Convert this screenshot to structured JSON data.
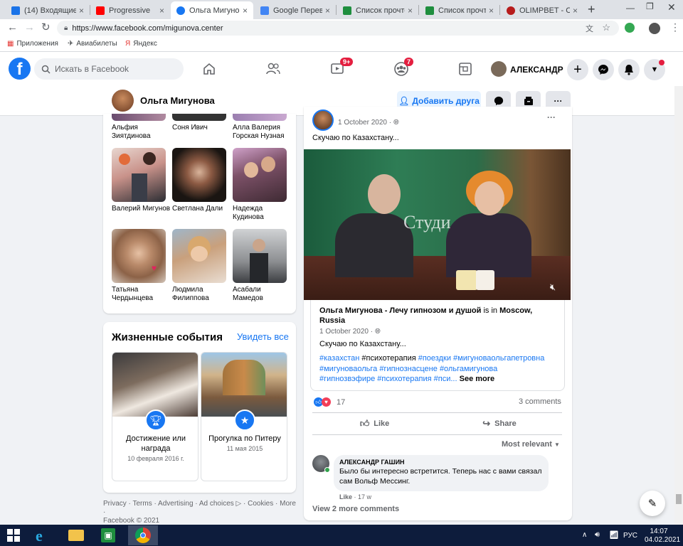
{
  "browser": {
    "tabs": [
      {
        "title": "(14) Входящие -",
        "color": "#1a73e8"
      },
      {
        "title": "Progressive",
        "color": "#ff0000"
      },
      {
        "title": "Ольга Мигунова",
        "color": "#1877f2"
      },
      {
        "title": "Google Перевод",
        "color": "#4285f4"
      },
      {
        "title": "Список прочтен",
        "color": "#1e8e3e"
      },
      {
        "title": "Список прочтен",
        "color": "#1e8e3e"
      },
      {
        "title": "OLIMPBET - Спо",
        "color": "#b71c1c"
      }
    ],
    "url": "https://www.facebook.com/migunova.center",
    "bookmarks": [
      "Приложения",
      "Авиабилеты",
      "Яндекс"
    ]
  },
  "fbnav": {
    "search_placeholder": "Искать в Facebook",
    "video_badge": "9+",
    "groups_badge": "7",
    "user_name": "АЛЕКСАНДР"
  },
  "profile": {
    "name": "Ольга Мигунова",
    "add_friend": "Добавить друга"
  },
  "friends": {
    "top_row": [
      "Альфия Зиятдинова",
      "Соня Ивич",
      "Алла Валерия Горская Нузная"
    ],
    "row2": [
      "Валерий Мигунов",
      "Светлана Дали",
      "Надежда Кудинова"
    ],
    "row3": [
      "Татьяна Чердынцева",
      "Людмила Филиппова",
      "Асабали Мамедов"
    ]
  },
  "life_events": {
    "title": "Жизненные события",
    "see_all": "Увидеть все",
    "items": [
      {
        "title": "Достижение или награда",
        "date": "10 февраля 2016 г."
      },
      {
        "title": "Прогулка по Питеру",
        "date": "11 мая 2015"
      }
    ]
  },
  "footer": {
    "links": "Privacy · Terms · Advertising · Ad choices ▷ · Cookies · More ·",
    "copyright": "Facebook © 2021"
  },
  "post": {
    "date": "1 October 2020 ·",
    "text": "Скучаю по Казахстану...",
    "video_caption": "Студи",
    "shared_author": "Ольга Мигунова - Лечу гипнозом и душой",
    "shared_is_in": " is in ",
    "shared_location": "Moscow, Russia",
    "shared_date": "1 October 2020 ·",
    "shared_text": "Скучаю по Казахстану...",
    "tags_line1": [
      "#казахстан",
      "#психотерапия",
      "#поездки",
      "#мигуноваольгапетровна"
    ],
    "tags_line2": [
      "#мигуноваольга",
      "#гипнознасцене",
      "#ольгамигунова"
    ],
    "tags_line3": [
      "#гипнозвэфире",
      "#психотерапия",
      "#пси..."
    ],
    "see_more": "See more",
    "reactions_count": "17",
    "comments_count": "3 comments",
    "like": "Like",
    "share": "Share",
    "most_relevant": "Most relevant",
    "comment": {
      "author": "АЛЕКСАНДР ГАШИН",
      "text": "Было бы интересно встретится. Теперь нас с вами связал сам Вольф Мессинг.",
      "like": "Like",
      "age": "· 17 w"
    },
    "view_more": "View 2 more comments"
  },
  "taskbar": {
    "lang": "РУС",
    "time": "14:07",
    "date": "04.02.2021"
  }
}
